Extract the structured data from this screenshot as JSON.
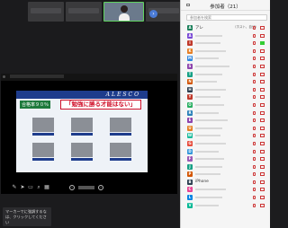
{
  "thumbnails": [
    {
      "kind": "blurred"
    },
    {
      "kind": "blurred"
    },
    {
      "kind": "speaker"
    },
    {
      "kind": "blurred"
    }
  ],
  "next_page_icon": "right-arrow-icon",
  "slide": {
    "logo": "ALESCO",
    "badge": "合格率９０％",
    "headline": "「勉強に勝る才能はない」"
  },
  "slide_controls": [
    "pen-icon",
    "mouse-icon",
    "eraser-icon",
    "zoom-icon",
    "grid-icon"
  ],
  "tooltip": "マーカーでに強調するな は、クリックしてください",
  "panel": {
    "title": "参加者（21）",
    "search_placeholder": "参加者を検索"
  },
  "participants": [
    {
      "initial": "A",
      "color": "#1a7f5a",
      "name": "アレ",
      "tag": "（ホスト、自分）",
      "cam": "off"
    },
    {
      "initial": "A",
      "color": "#7a4ad6",
      "name": "",
      "tag": "",
      "cam": "off"
    },
    {
      "initial": "I",
      "color": "#c0392b",
      "name": "",
      "tag": "",
      "cam": "green"
    },
    {
      "initial": "K",
      "color": "#e67e22",
      "name": "",
      "tag": "",
      "cam": "off"
    },
    {
      "initial": "M",
      "color": "#2e86de",
      "name": "",
      "tag": "",
      "cam": "off"
    },
    {
      "initial": "S",
      "color": "#8e44ad",
      "name": "",
      "tag": "",
      "cam": "off"
    },
    {
      "initial": "T",
      "color": "#16a085",
      "name": "",
      "tag": "",
      "cam": "off"
    },
    {
      "initial": "N",
      "color": "#d35400",
      "name": "",
      "tag": "",
      "cam": "off"
    },
    {
      "initial": "H",
      "color": "#2c3e50",
      "name": "",
      "tag": "",
      "cam": "off"
    },
    {
      "initial": "Y",
      "color": "#c0392b",
      "name": "",
      "tag": "",
      "cam": "off"
    },
    {
      "initial": "O",
      "color": "#27ae60",
      "name": "",
      "tag": "",
      "cam": "off"
    },
    {
      "initial": "R",
      "color": "#2980b9",
      "name": "",
      "tag": "",
      "cam": "off"
    },
    {
      "initial": "E",
      "color": "#8e44ad",
      "name": "",
      "tag": "",
      "cam": "off"
    },
    {
      "initial": "U",
      "color": "#e67e22",
      "name": "",
      "tag": "",
      "cam": "off"
    },
    {
      "initial": "W",
      "color": "#1abc9c",
      "name": "",
      "tag": "",
      "cam": "off"
    },
    {
      "initial": "G",
      "color": "#e74c3c",
      "name": "",
      "tag": "",
      "cam": "off"
    },
    {
      "initial": "D",
      "color": "#3498db",
      "name": "",
      "tag": "",
      "cam": "off"
    },
    {
      "initial": "F",
      "color": "#9b59b6",
      "name": "",
      "tag": "",
      "cam": "off"
    },
    {
      "initial": "J",
      "color": "#16a085",
      "name": "",
      "tag": "",
      "cam": "off"
    },
    {
      "initial": "P",
      "color": "#d35400",
      "name": "",
      "tag": "",
      "cam": "off"
    },
    {
      "initial": "B",
      "color": "#2c3e50",
      "name": "iPhone",
      "tag": "",
      "cam": "off"
    },
    {
      "initial": "C",
      "color": "#e84393",
      "name": "",
      "tag": "",
      "cam": "off"
    },
    {
      "initial": "L",
      "color": "#0984e3",
      "name": "",
      "tag": "",
      "cam": "off"
    },
    {
      "initial": "V",
      "color": "#00b894",
      "name": "",
      "tag": "",
      "cam": "off"
    }
  ],
  "colors": {
    "slide_accent": "#1e3c8c",
    "headline_red": "#d0102a",
    "active_green": "#5fd35f"
  }
}
